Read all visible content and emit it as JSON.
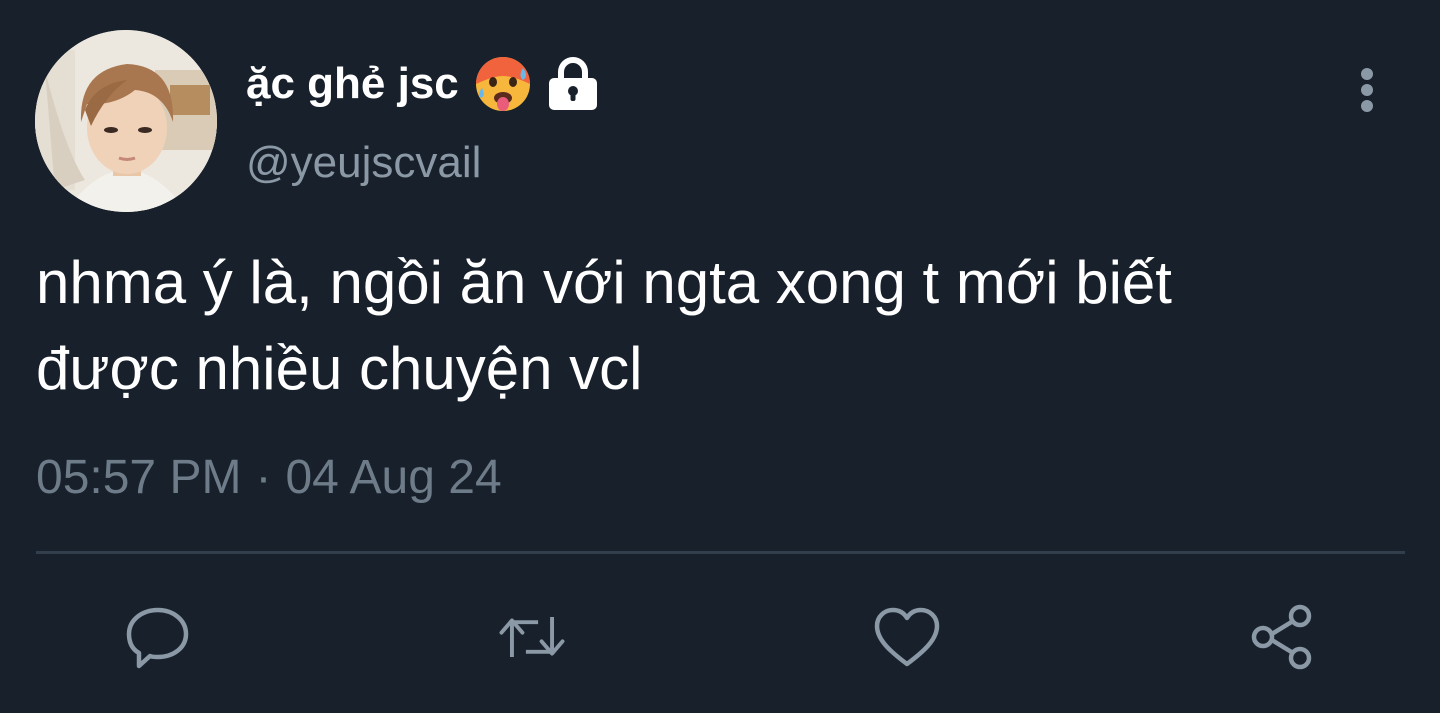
{
  "author": {
    "display_name": "ặc ghẻ jsc",
    "handle": "@yeujscvail",
    "badges": [
      "hot-face-emoji-icon",
      "lock-icon"
    ]
  },
  "tweet": {
    "text_lines": [
      "nhma ý là, ngồi ăn với ngta xong t mới biết",
      "được nhiều chuyện vcl"
    ],
    "time": "05:57 PM",
    "separator": "·",
    "date": "04 Aug 24"
  },
  "actions": [
    "reply-icon",
    "retweet-icon",
    "like-icon",
    "share-icon"
  ],
  "colors": {
    "background": "#17202b",
    "text": "#ffffff",
    "muted": "#8b98a5",
    "divider": "#323e4c"
  }
}
